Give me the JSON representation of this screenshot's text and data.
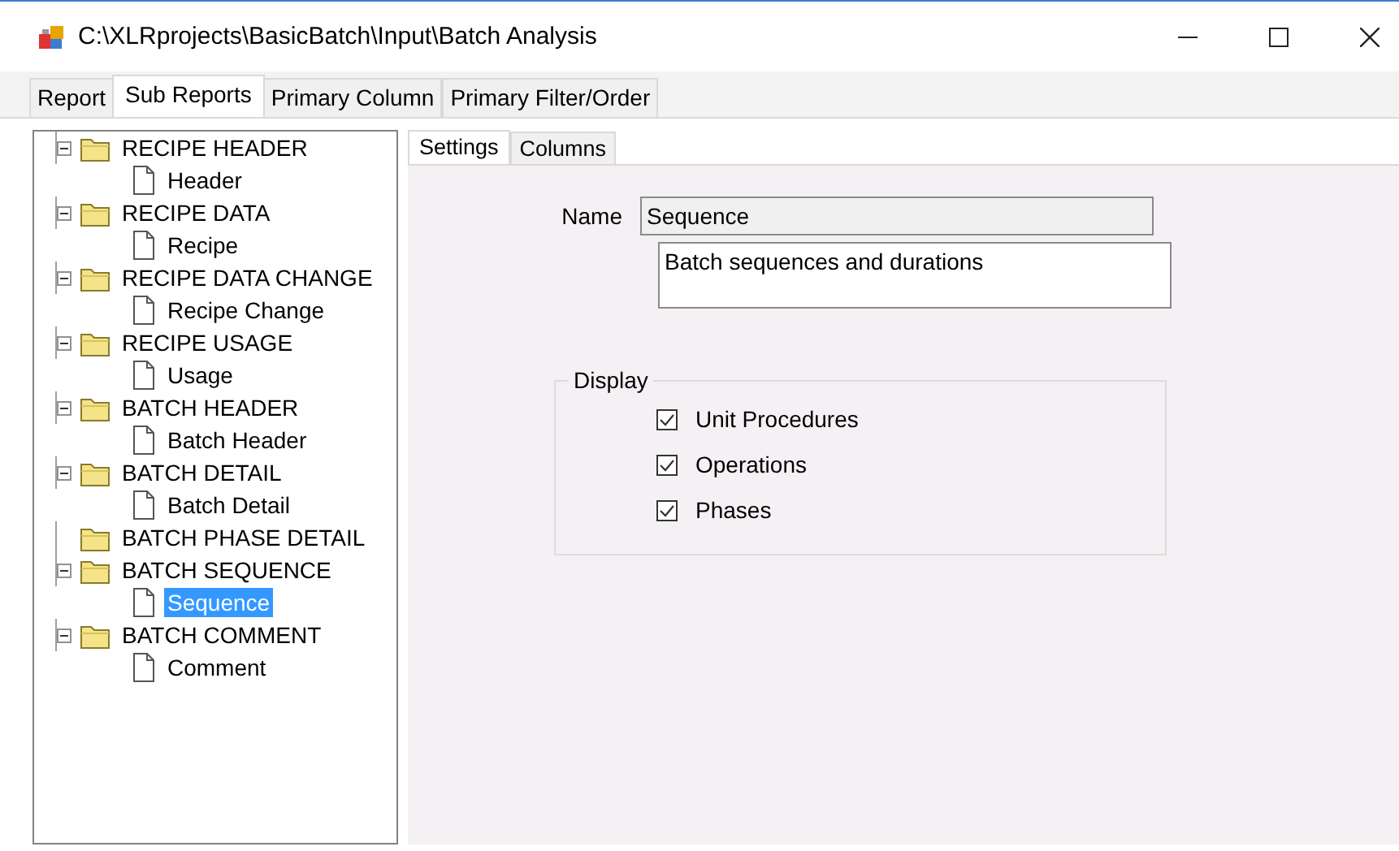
{
  "window": {
    "title": "C:\\XLRprojects\\BasicBatch\\Input\\Batch Analysis"
  },
  "tabs": [
    {
      "label": "Report",
      "selected": false
    },
    {
      "label": "Sub Reports",
      "selected": true
    },
    {
      "label": "Primary Column",
      "selected": false
    },
    {
      "label": "Primary Filter/Order",
      "selected": false
    }
  ],
  "tree": [
    {
      "label": "RECIPE HEADER",
      "expanded": true,
      "children": [
        {
          "label": "Header",
          "selected": false
        }
      ]
    },
    {
      "label": "RECIPE DATA",
      "expanded": true,
      "children": [
        {
          "label": "Recipe",
          "selected": false
        }
      ]
    },
    {
      "label": "RECIPE DATA CHANGE",
      "expanded": true,
      "children": [
        {
          "label": "Recipe Change",
          "selected": false
        }
      ]
    },
    {
      "label": "RECIPE USAGE",
      "expanded": true,
      "children": [
        {
          "label": "Usage",
          "selected": false
        }
      ]
    },
    {
      "label": "BATCH HEADER",
      "expanded": true,
      "children": [
        {
          "label": "Batch Header",
          "selected": false
        }
      ]
    },
    {
      "label": "BATCH DETAIL",
      "expanded": true,
      "children": [
        {
          "label": "Batch Detail",
          "selected": false
        }
      ]
    },
    {
      "label": "BATCH PHASE DETAIL"
    },
    {
      "label": "BATCH SEQUENCE",
      "expanded": true,
      "children": [
        {
          "label": "Sequence",
          "selected": true
        }
      ]
    },
    {
      "label": "BATCH COMMENT",
      "expanded": true,
      "children": [
        {
          "label": "Comment",
          "selected": false
        }
      ]
    }
  ],
  "detail_tabs": [
    {
      "label": "Settings",
      "selected": true
    },
    {
      "label": "Columns",
      "selected": false
    }
  ],
  "name_field": {
    "label": "Name",
    "value": "Sequence"
  },
  "description": {
    "value": "Batch sequences and durations"
  },
  "display_group": {
    "title": "Display",
    "options": [
      {
        "label": "Unit Procedures",
        "checked": true
      },
      {
        "label": "Operations",
        "checked": true
      },
      {
        "label": "Phases",
        "checked": true
      }
    ]
  }
}
